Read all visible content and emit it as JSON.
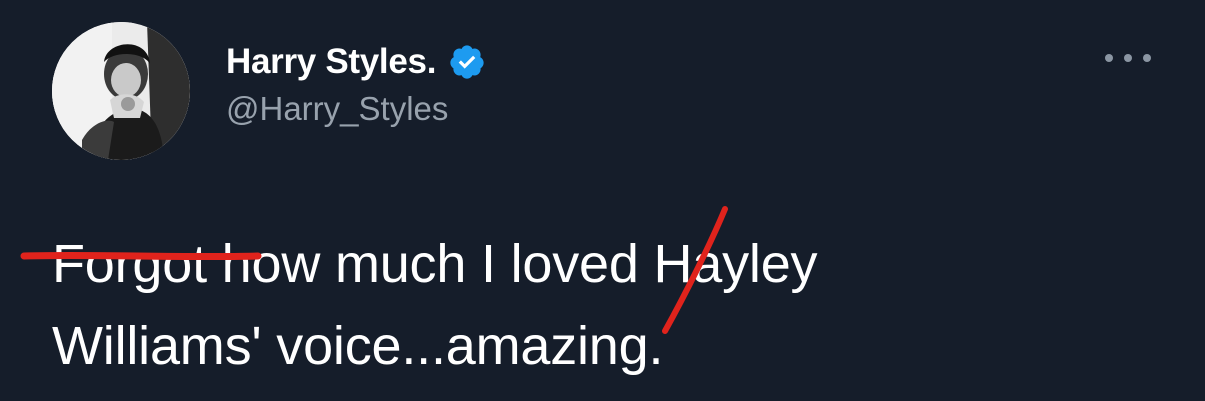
{
  "tweet": {
    "author": {
      "display_name": "Harry Styles.",
      "handle": "@Harry_Styles",
      "verified": true,
      "avatar_icon": "avatar-photo"
    },
    "text": {
      "struck_word": "Forgot",
      "line1_rest": " how much I loved Hayley",
      "line2": "Williams' voice...amazing."
    },
    "more_icon": "more-horizontal-icon",
    "colors": {
      "background": "#151d2a",
      "text": "#ffffff",
      "secondary_text": "#98a2ad",
      "verified": "#1d9bf0",
      "annotation": "#e0231c"
    }
  }
}
